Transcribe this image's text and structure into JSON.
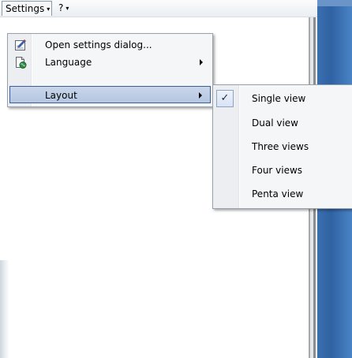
{
  "menubar": {
    "settings_label": "Settings",
    "help_label": "?",
    "dropdown_glyph": "▾"
  },
  "settings_menu": {
    "items": [
      {
        "label": "Open settings dialog...",
        "icon": "settings-dialog-icon",
        "has_submenu": false
      },
      {
        "label": "Language",
        "icon": "language-icon",
        "has_submenu": true
      },
      {
        "label": "Layout",
        "icon": "",
        "has_submenu": true,
        "highlighted": true
      }
    ]
  },
  "layout_submenu": {
    "check_glyph": "✓",
    "items": [
      {
        "label": "Single view",
        "checked": true
      },
      {
        "label": "Dual view",
        "checked": false
      },
      {
        "label": "Three views",
        "checked": false
      },
      {
        "label": "Four views",
        "checked": false
      },
      {
        "label": "Penta view",
        "checked": false
      }
    ]
  },
  "colors": {
    "menu_highlight": "#b5c6e1",
    "menu_highlight_border": "#3b5f9b",
    "right_pane": "#2f62a3"
  }
}
